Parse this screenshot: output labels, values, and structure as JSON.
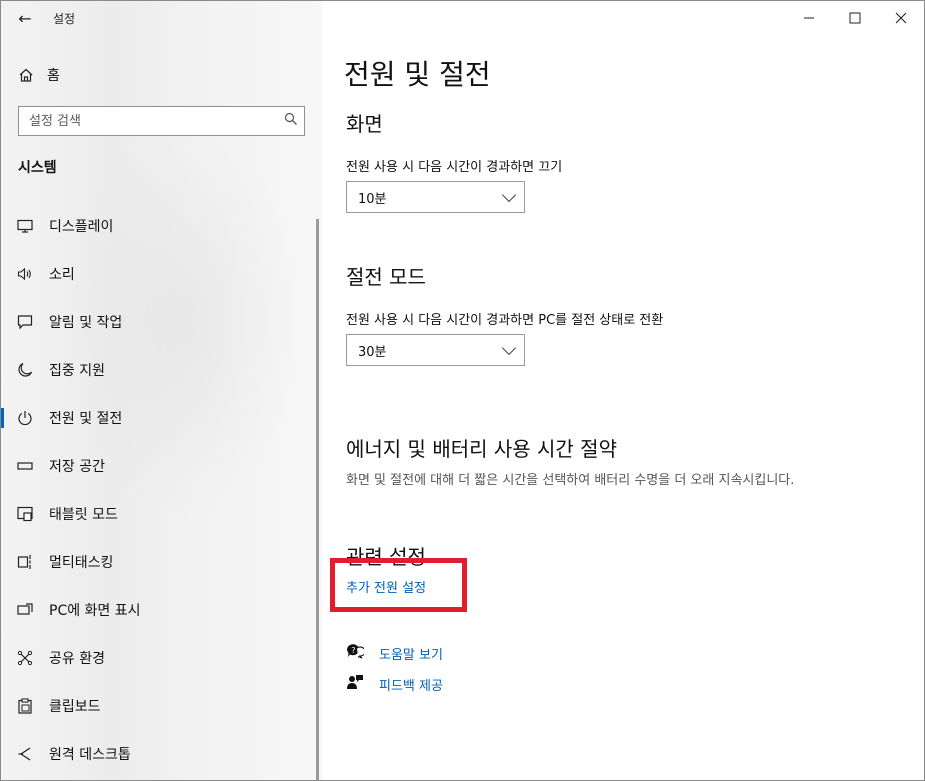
{
  "window": {
    "app_title": "설정"
  },
  "controls": {
    "minimize": "—",
    "maximize": "☐",
    "close": "✕"
  },
  "sidebar": {
    "back_glyph": "←",
    "home_label": "홈",
    "search_placeholder": "설정 검색",
    "section_label": "시스템",
    "items": [
      {
        "label": "디스플레이",
        "icon": "monitor-icon",
        "glyph": "▭"
      },
      {
        "label": "소리",
        "icon": "speaker-icon",
        "glyph": "🔈"
      },
      {
        "label": "알림 및 작업",
        "icon": "notification-icon",
        "glyph": "▢"
      },
      {
        "label": "집중 지원",
        "icon": "moon-icon",
        "glyph": "☽"
      },
      {
        "label": "전원 및 절전",
        "icon": "power-icon",
        "glyph": "⏻",
        "active": true
      },
      {
        "label": "저장 공간",
        "icon": "storage-icon",
        "glyph": "▭"
      },
      {
        "label": "태블릿 모드",
        "icon": "tablet-icon",
        "glyph": "▣"
      },
      {
        "label": "멀티태스킹",
        "icon": "multitask-icon",
        "glyph": "⧉"
      },
      {
        "label": "PC에 화면 표시",
        "icon": "project-icon",
        "glyph": "⎚"
      },
      {
        "label": "공유 환경",
        "icon": "share-icon",
        "glyph": "✕"
      },
      {
        "label": "클립보드",
        "icon": "clipboard-icon",
        "glyph": "📋"
      },
      {
        "label": "원격 데스크톱",
        "icon": "remote-icon",
        "glyph": "⟩"
      }
    ]
  },
  "main": {
    "title": "전원 및 절전",
    "screen": {
      "heading": "화면",
      "label": "전원 사용 시 다음 시간이 경과하면 끄기",
      "value": "10분"
    },
    "sleep": {
      "heading": "절전 모드",
      "label": "전원 사용 시 다음 시간이 경과하면 PC를 절전 상태로 전환",
      "value": "30분"
    },
    "energy": {
      "heading": "에너지 및 배터리 사용 시간 절약",
      "desc": "화면 및 절전에 대해 더 짧은 시간을 선택하여 배터리 수명을 더 오래 지속시킵니다."
    },
    "related": {
      "heading": "관련 설정",
      "link": "추가 전원 설정"
    },
    "help": {
      "label": "도움말 보기",
      "icon": "help-icon"
    },
    "feedback": {
      "label": "피드백 제공",
      "icon": "feedback-icon"
    }
  },
  "colors": {
    "accent": "#0067c0",
    "link": "#0060b8",
    "highlight": "#e21e2d"
  }
}
